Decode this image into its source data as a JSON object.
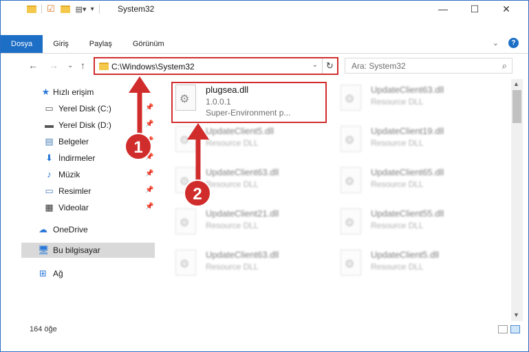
{
  "window": {
    "title": "System32",
    "minimize": "—",
    "maximize": "☐",
    "close": "✕"
  },
  "ribbon": {
    "tabs": [
      "Dosya",
      "Giriş",
      "Paylaş",
      "Görünüm"
    ],
    "expand_icon": "chevron-down-icon",
    "help_label": "?"
  },
  "address": {
    "path": "C:\\Windows\\System32",
    "search_placeholder": "Ara: System32"
  },
  "sidebar": {
    "items": [
      {
        "label": "Hızlı erişim",
        "icon": "star-icon",
        "pinned": false
      },
      {
        "label": "Yerel Disk (C:)",
        "icon": "drive-icon",
        "pinned": true
      },
      {
        "label": "Yerel Disk (D:)",
        "icon": "drive-icon",
        "pinned": true
      },
      {
        "label": "Belgeler",
        "icon": "documents-icon",
        "pinned": true
      },
      {
        "label": "İndirmeler",
        "icon": "download-icon",
        "pinned": true
      },
      {
        "label": "Müzik",
        "icon": "music-icon",
        "pinned": true
      },
      {
        "label": "Resimler",
        "icon": "pictures-icon",
        "pinned": true
      },
      {
        "label": "Videolar",
        "icon": "video-icon",
        "pinned": true
      },
      {
        "label": "OneDrive",
        "icon": "cloud-icon",
        "pinned": false
      },
      {
        "label": "Bu bilgisayar",
        "icon": "computer-icon",
        "pinned": false,
        "selected": true
      },
      {
        "label": "Ağ",
        "icon": "network-icon",
        "pinned": false
      }
    ]
  },
  "files": {
    "highlighted": {
      "name": "plugsea.dll",
      "version": "1.0.0.1",
      "description": "Super-Environment p..."
    },
    "blurred": [
      {
        "name": "UpdateClient63.dll",
        "type": "Resource DLL"
      },
      {
        "name": "UpdateClient5.dll",
        "type": "Resource DLL"
      },
      {
        "name": "UpdateClient19.dll",
        "type": "Resource DLL"
      },
      {
        "name": "UpdateClient63.dll",
        "type": "Resource DLL"
      },
      {
        "name": "UpdateClient65.dll",
        "type": "Resource DLL"
      },
      {
        "name": "UpdateClient21.dll",
        "type": "Resource DLL"
      },
      {
        "name": "UpdateClient55.dll",
        "type": "Resource DLL"
      },
      {
        "name": "UpdateClient63.dll",
        "type": "Resource DLL"
      },
      {
        "name": "UpdateClient5.dll",
        "type": "Resource DLL"
      }
    ]
  },
  "status": {
    "count": "164 öğe"
  },
  "annotations": {
    "marker_1": "1",
    "marker_2": "2",
    "color": "#d12c2c"
  }
}
